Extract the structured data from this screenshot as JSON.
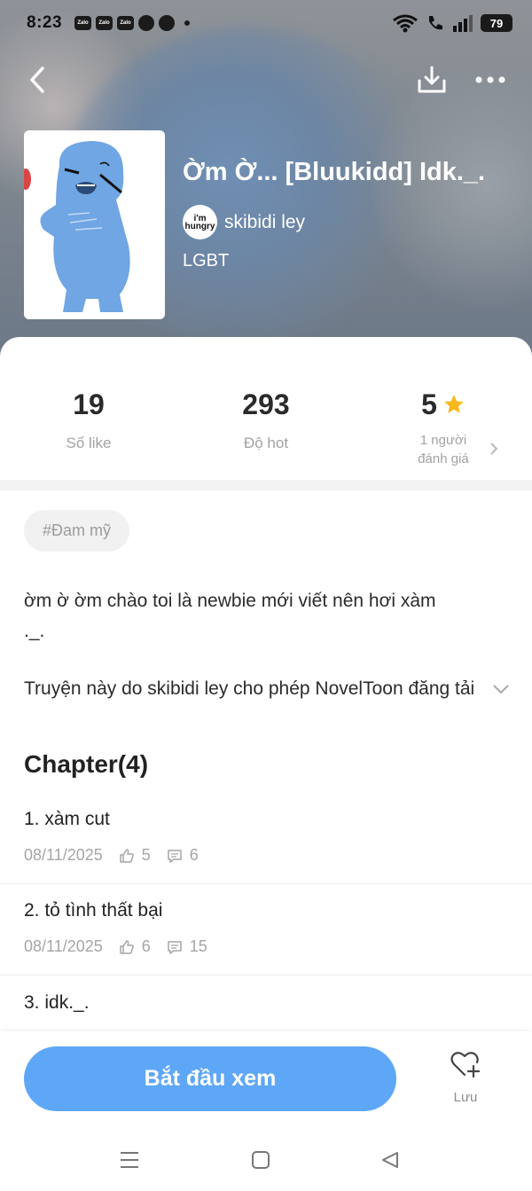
{
  "status_bar": {
    "time": "8:23",
    "app_icons": [
      "Zalo",
      "Zalo",
      "Zalo"
    ],
    "battery": "79"
  },
  "novel": {
    "title": "Ờm Ờ... [Bluukidd] Idk._.",
    "author": "skibidi ley",
    "author_avatar_text": "i'm hungry",
    "genre": "LGBT"
  },
  "stats": {
    "likes_value": "19",
    "likes_label": "Số like",
    "hot_value": "293",
    "hot_label": "Độ hot",
    "rating_value": "5",
    "rating_line1": "1 người",
    "rating_line2": "đánh giá"
  },
  "tag": "#Đam mỹ",
  "description": "ờm ờ ờm chào toi là newbie mới viết nên hơi xàm ._.",
  "permission": "Truyện này do skibidi ley cho phép NovelToon đăng tải",
  "chapters_heading": "Chapter(4)",
  "chapters": [
    {
      "title": "1. xàm cut",
      "date": "08/11/2025",
      "likes": "5",
      "comments": "6"
    },
    {
      "title": "2. tỏ tình thất bại",
      "date": "08/11/2025",
      "likes": "6",
      "comments": "15"
    },
    {
      "title": "3. idk._."
    }
  ],
  "actions": {
    "start_label": "Bắt đầu xem",
    "save_label": "Lưu"
  },
  "colors": {
    "accent": "#5ea7f6",
    "star": "#f6b81a",
    "muted": "#a2a2a2"
  },
  "icons": [
    "back-arrow-icon",
    "download-icon",
    "more-icon",
    "star-icon",
    "chevron-right-icon",
    "chevron-down-icon",
    "thumbs-up-icon",
    "comment-icon",
    "heart-plus-icon",
    "menu-icon",
    "home-icon",
    "back-triangle-icon"
  ]
}
